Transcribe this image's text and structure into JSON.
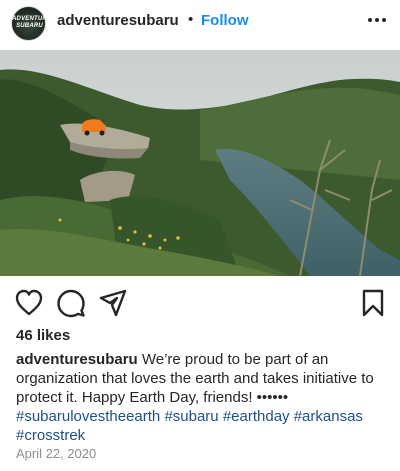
{
  "header": {
    "avatar_text": "ADVENTURE SUBARU",
    "username": "adventuresubaru",
    "separator": "•",
    "follow_label": "Follow"
  },
  "post": {
    "image_watermark": "",
    "likes_text": "46 likes",
    "caption": {
      "username": "adventuresubaru",
      "text": " We’re proud to be part of an organization that loves the earth and takes initiative to protect it. Happy Earth Day, friends! ••••••",
      "hashtags": [
        "#subarulovestheearth",
        "#subaru",
        "#earthday",
        "#arkansas",
        "#crosstrek"
      ]
    },
    "date": "April 22, 2020"
  },
  "icons": {
    "like": "heart-outline-icon",
    "comment": "comment-bubble-icon",
    "share": "paper-plane-icon",
    "save": "bookmark-outline-icon",
    "more": "more-horizontal-icon"
  },
  "colors": {
    "text": "#262626",
    "follow": "#1a8cf0",
    "hashtag": "#1f4f8b",
    "muted": "#8e8e8e"
  }
}
